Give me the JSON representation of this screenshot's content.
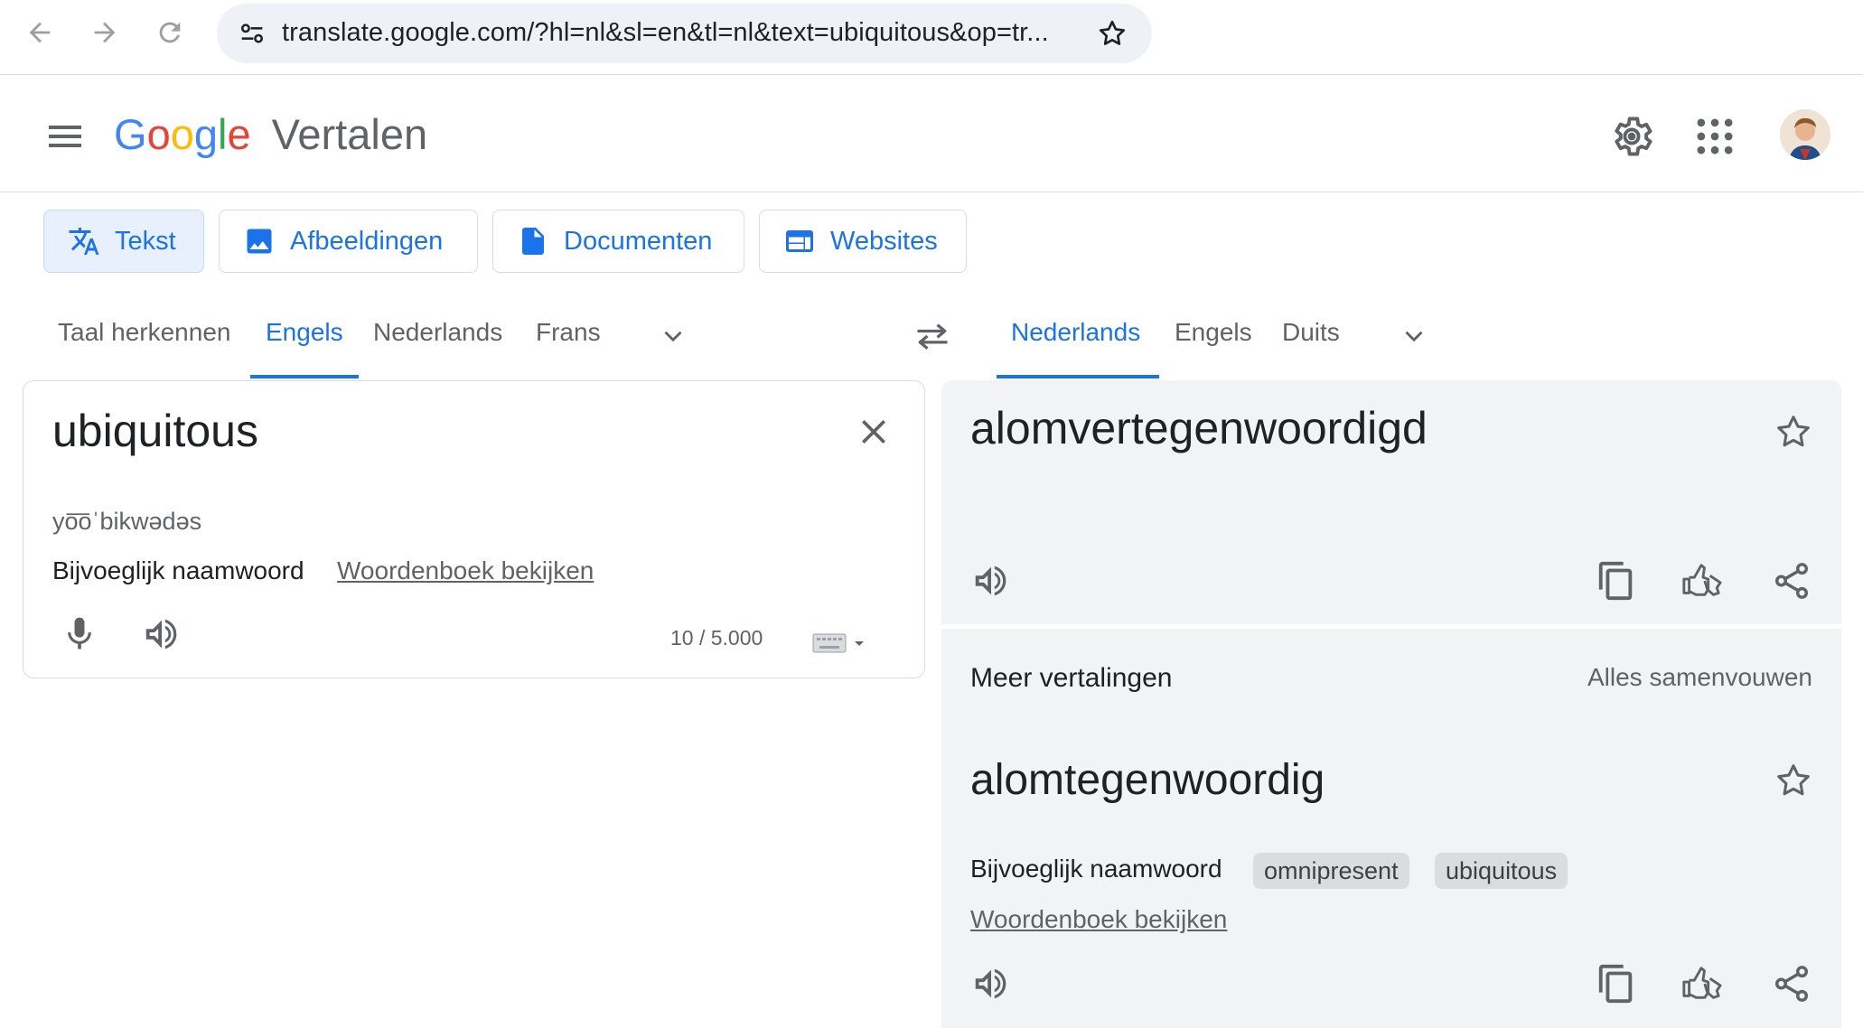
{
  "browser": {
    "url": "translate.google.com/?hl=nl&sl=en&tl=nl&text=ubiquitous&op=tr..."
  },
  "header": {
    "logo_letters": [
      "G",
      "o",
      "o",
      "g",
      "l",
      "e"
    ],
    "product": "Vertalen"
  },
  "modes": [
    {
      "label": "Tekst",
      "icon": "translate-icon",
      "active": true
    },
    {
      "label": "Afbeeldingen",
      "icon": "image-icon",
      "active": false
    },
    {
      "label": "Documenten",
      "icon": "document-icon",
      "active": false
    },
    {
      "label": "Websites",
      "icon": "website-icon",
      "active": false
    }
  ],
  "source_langs": [
    "Taal herkennen",
    "Engels",
    "Nederlands",
    "Frans"
  ],
  "source_active": "Engels",
  "target_langs": [
    "Nederlands",
    "Engels",
    "Duits"
  ],
  "target_active": "Nederlands",
  "source": {
    "text": "ubiquitous",
    "phonetic": "yo͞oˈbikwədəs",
    "pos": "Bijvoeglijk naamwoord",
    "dict_link": "Woordenboek bekijken",
    "char_count": "10 / 5.000"
  },
  "target": {
    "text": "alomvertegenwoordigd"
  },
  "more": {
    "title": "Meer vertalingen",
    "collapse_label": "Alles samenvouwen",
    "word": "alomtegenwoordig",
    "pos": "Bijvoeglijk naamwoord",
    "chips": [
      "omnipresent",
      "ubiquitous"
    ],
    "dict_link": "Woordenboek bekijken"
  },
  "colors": {
    "accent": "#1a73e8",
    "panel_bg": "#f1f3f4",
    "active_mode_bg": "#e8f0fe"
  }
}
